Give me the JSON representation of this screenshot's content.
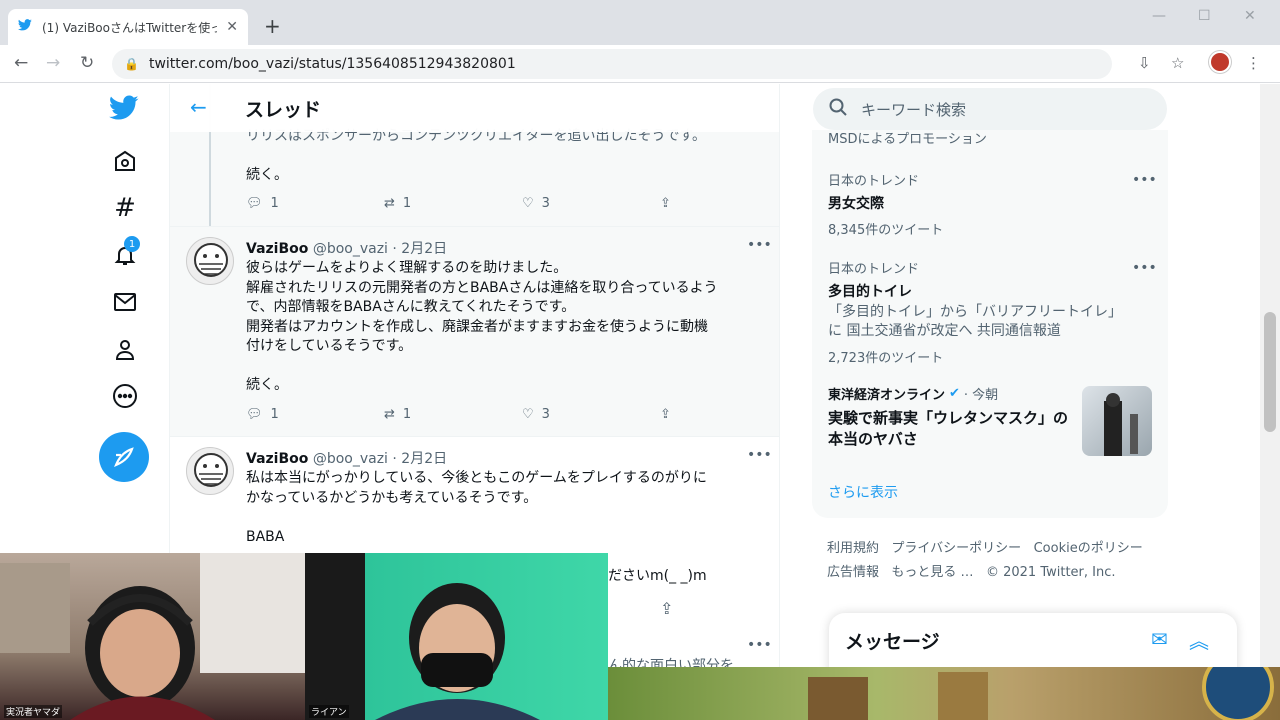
{
  "browser": {
    "tab_title": "(1) VaziBooさんはTwitterを使ってい",
    "url": "twitter.com/boo_vazi/status/1356408512943820801"
  },
  "header": {
    "title": "スレッド"
  },
  "tweets": [
    {
      "partial_text": "リリスはスポンサーからコンテンツクリエイターを追い出したそうです。",
      "more": "続く。",
      "replies": "1",
      "retweets": "1",
      "likes": "3"
    },
    {
      "name": "VaziBoo",
      "handle": "@boo_vazi",
      "date": "· 2月2日",
      "lines": [
        "彼らはゲームをよりよく理解するのを助けました。",
        "解雇されたリリスの元開発者の方とBABAさんは連絡を取り合っているよう",
        "で、内部情報をBABAさんに教えてくれたそうです。",
        "開発者はアカウントを作成し、廃課金者がますますお金を使うように動機",
        "付けをしているそうです。"
      ],
      "more": "続く。",
      "replies": "1",
      "retweets": "1",
      "likes": "3"
    },
    {
      "name": "VaziBoo",
      "handle": "@boo_vazi",
      "date": "· 2月2日",
      "lines": [
        "私は本当にがっかりしている、今後ともこのゲームをプレイするのがりに",
        "かなっているかどうかも考えているそうです。"
      ],
      "sig": "BABA",
      "tail": "ださいm(_ _)m",
      "cut": "ん的な面白い部分を"
    }
  ],
  "sidebar": {
    "notification_count": "1"
  },
  "right": {
    "search_placeholder": "キーワード検索",
    "promo_partial": "MSDによるプロモーション",
    "trends": [
      {
        "category": "日本のトレンド",
        "name": "男女交際",
        "count": "8,345件のツイート"
      },
      {
        "category": "日本のトレンド",
        "name": "多目的トイレ",
        "desc1": "「多目的トイレ」から「バリアフリートイレ」",
        "desc2": "に 国土交通省が改定へ 共同通信報道",
        "count": "2,723件のツイート"
      }
    ],
    "news": {
      "source": "東洋経済オンライン",
      "time": "· 今朝",
      "title1": "実験で新事実「ウレタンマスク」の",
      "title2": "本当のヤバさ"
    },
    "show_more": "さらに表示",
    "footer1": [
      "利用規約",
      "プライバシーポリシー",
      "Cookieのポリシー"
    ],
    "footer2": [
      "広告情報",
      "もっと見る …",
      "© 2021 Twitter, Inc."
    ],
    "messages": "メッセージ"
  },
  "webcams": {
    "left_label": "実況者ヤマダ",
    "right_label": "ライアン"
  },
  "colors": {
    "accent": "#1d9bf0",
    "text": "#0f1419",
    "secondary": "#536471"
  }
}
